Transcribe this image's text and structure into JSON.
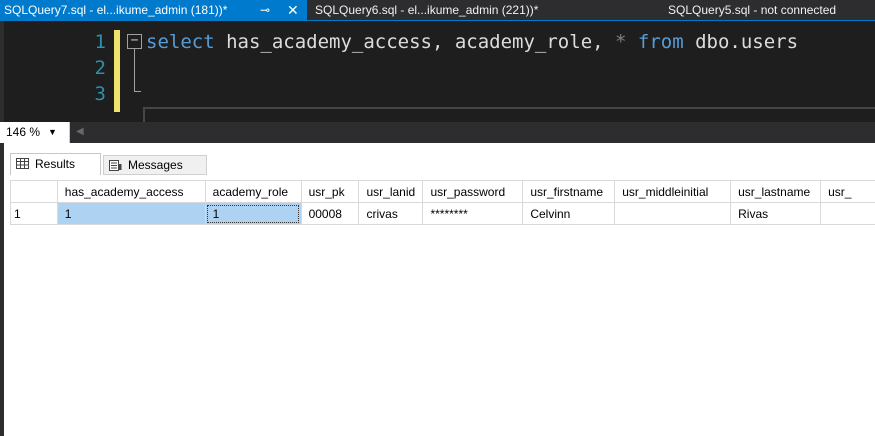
{
  "tabs": [
    {
      "label": "SQLQuery7.sql - el...ikume_admin (181))*",
      "active": true,
      "pin": "⊸",
      "close": "✕"
    },
    {
      "label": "SQLQuery6.sql - el...ikume_admin (221))*"
    },
    {
      "label": "SQLQuery5.sql - not connected"
    }
  ],
  "editor": {
    "line_numbers": [
      "1",
      "2",
      "3"
    ],
    "fold_glyph": "−",
    "code": {
      "kw_select": "select",
      "rest_1": " has_academy_access, academy_role, ",
      "star": "*",
      "kw_from": " from",
      "rest_2": " dbo.users"
    }
  },
  "zoom": {
    "value": "146 %",
    "arrow": "▼",
    "scroll_arrow": "◀"
  },
  "results": {
    "tabs": [
      {
        "label": "Results",
        "icon": "grid-icon"
      },
      {
        "label": "Messages",
        "icon": "messages-icon"
      }
    ],
    "columns": [
      "",
      "has_academy_access",
      "academy_role",
      "usr_pk",
      "usr_lanid",
      "usr_password",
      "usr_firstname",
      "usr_middleinitial",
      "usr_lastname",
      "usr_"
    ],
    "rows": [
      [
        "1",
        "1",
        "1",
        "00008",
        "crivas",
        "********",
        "Celvinn",
        "",
        "Rivas",
        ""
      ]
    ]
  },
  "colors": {
    "accent": "#007acc",
    "editor_bg": "#1e1e1e",
    "keyword": "#569cd6",
    "line_number": "#2b91af",
    "change_bar": "#efe36b",
    "selection": "#add2f2"
  }
}
